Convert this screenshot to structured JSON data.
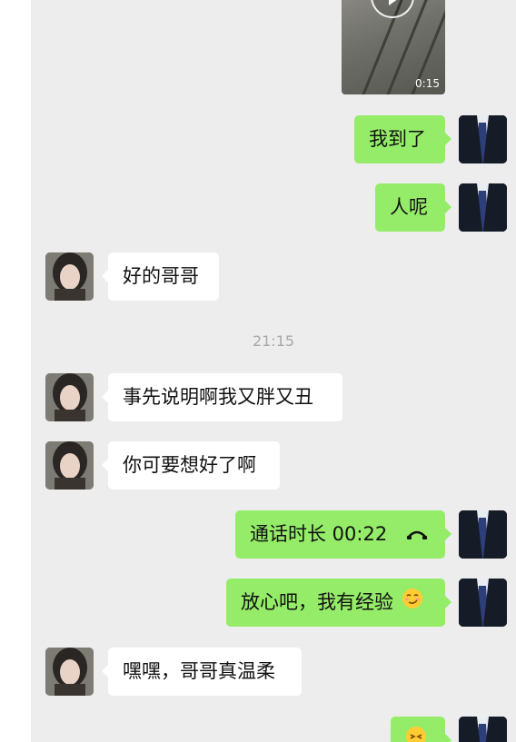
{
  "video": {
    "duration": "0:15"
  },
  "timestamp": "21:15",
  "messages": [
    {
      "side": "me",
      "text": "我到了"
    },
    {
      "side": "me",
      "text": "人呢"
    },
    {
      "side": "her",
      "text": "好的哥哥"
    },
    {
      "side": "her",
      "text": "事先说明啊我又胖又丑"
    },
    {
      "side": "her",
      "text": "你可要想好了啊"
    },
    {
      "side": "me",
      "text": "通话时长 00:22",
      "icon": "phone-hangup-icon"
    },
    {
      "side": "me",
      "text": "放心吧，我有经验",
      "icon": "smirk-emoji-icon"
    },
    {
      "side": "her",
      "text": "嘿嘿，哥哥真温柔"
    },
    {
      "side": "me",
      "text": "",
      "icon": "emoji-icon"
    }
  ],
  "colors": {
    "chat_bg": "#ededed",
    "my_bubble": "#95ec69",
    "her_bubble": "#ffffff",
    "timestamp": "#a8a8a8"
  }
}
